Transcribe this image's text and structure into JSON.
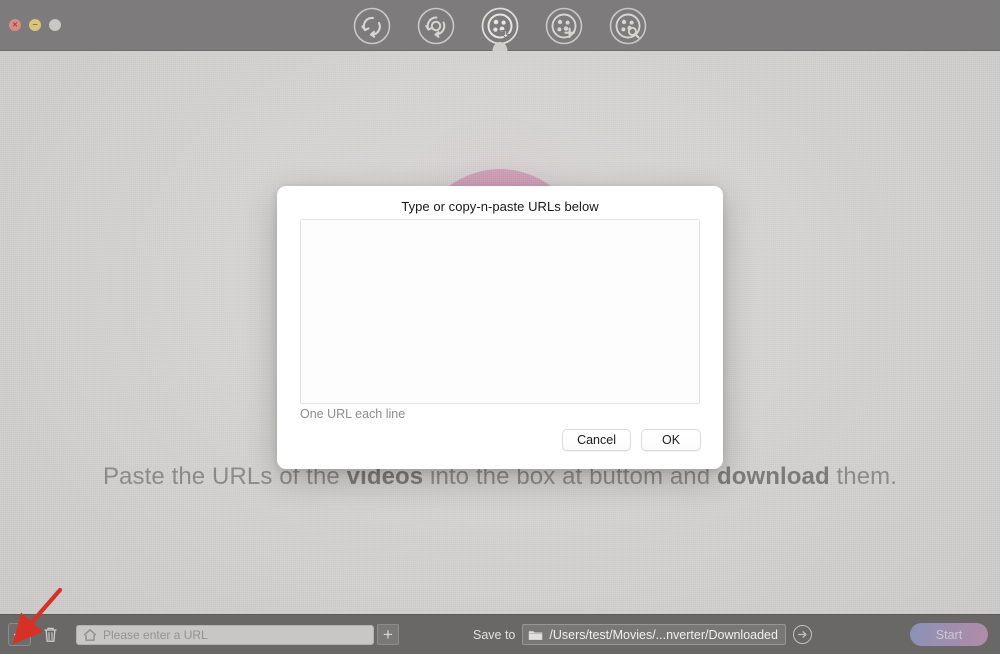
{
  "window": {
    "traffic_lights": [
      {
        "name": "close",
        "glyph": "×",
        "color": "#d98b85"
      },
      {
        "name": "minimize",
        "glyph": "−",
        "color": "#d9c47f"
      },
      {
        "name": "maximize",
        "glyph": "",
        "color": "#c9c7c6"
      }
    ]
  },
  "toolbar": {
    "items": [
      {
        "name": "convert-icon",
        "label": "Convert",
        "selected": false
      },
      {
        "name": "record-icon",
        "label": "Record",
        "selected": false
      },
      {
        "name": "download-icon",
        "label": "Download",
        "selected": true
      },
      {
        "name": "edit-icon",
        "label": "Edit",
        "selected": false
      },
      {
        "name": "search-icon",
        "label": "Search",
        "selected": false
      }
    ]
  },
  "canvas": {
    "hint_prefix": "Paste the URLs of the ",
    "hint_bold_1": "videos",
    "hint_middle": " into the box at buttom and ",
    "hint_bold_2": "download",
    "hint_suffix": " them."
  },
  "dialog": {
    "title": "Type or copy-n-paste URLs below",
    "textarea_value": "",
    "textarea_placeholder": "",
    "note": "One URL each line",
    "cancel_label": "Cancel",
    "ok_label": "OK"
  },
  "bottom_bar": {
    "add_button_label": "+",
    "delete_button_name": "trash-icon",
    "url_placeholder": "Please enter a URL",
    "url_value": "",
    "url_add_label": "+",
    "save_to_label": "Save to",
    "save_path": "/Users/test/Movies/...nverter/Downloaded",
    "reveal_label": "→",
    "start_label": "Start"
  },
  "annotation": {
    "arrow_color": "#d93025",
    "points_at": "add-url-button"
  }
}
